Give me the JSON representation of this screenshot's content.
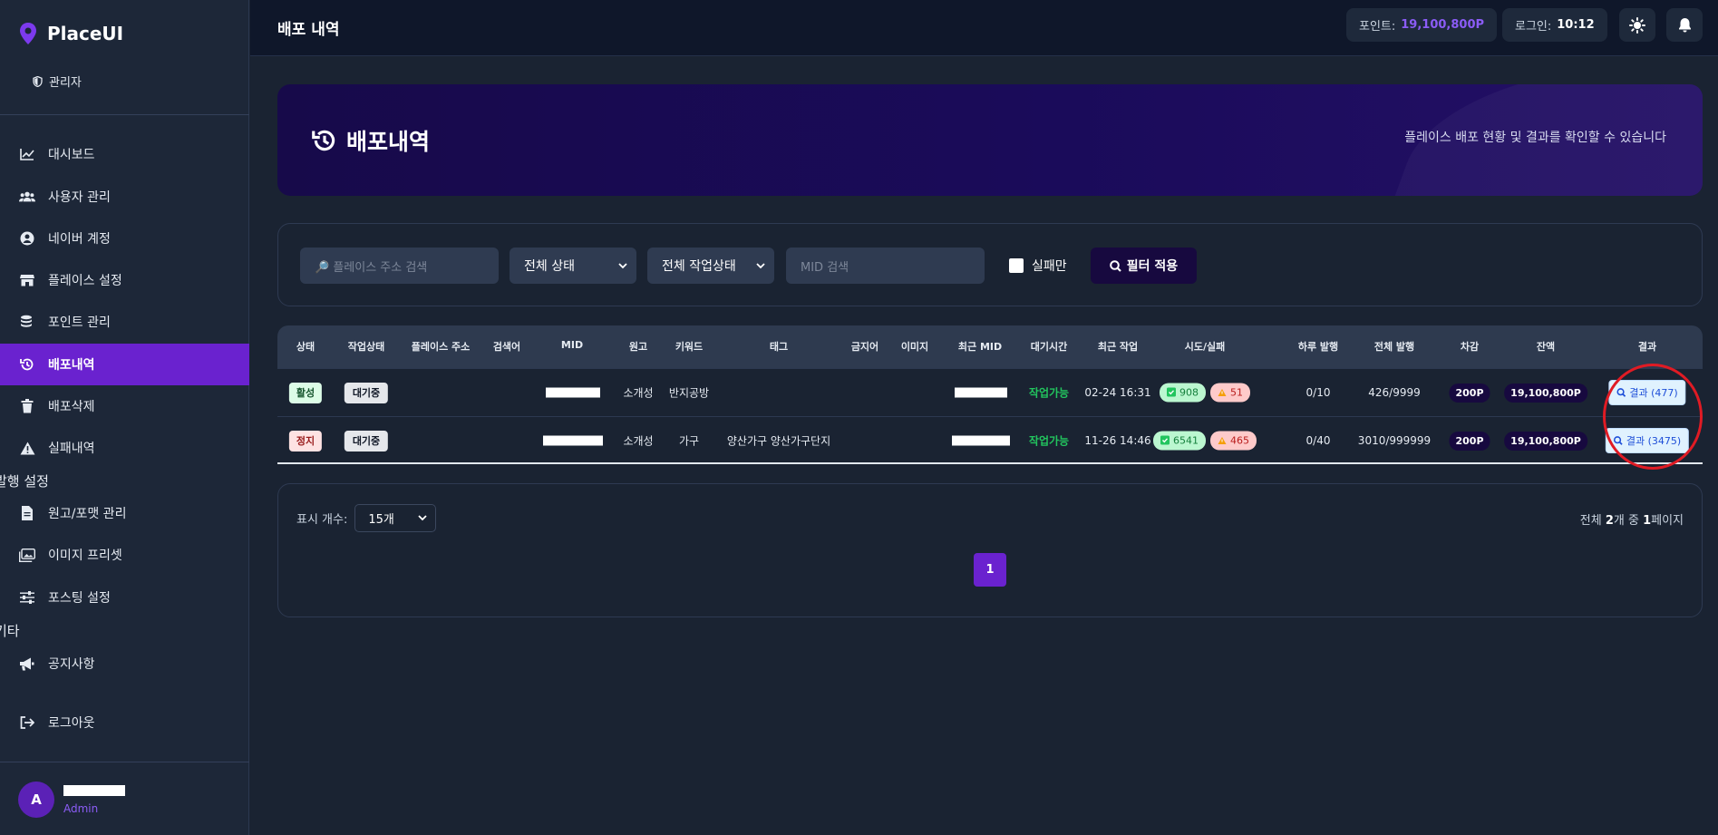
{
  "app": {
    "name": "PlaceUI",
    "role": "관리자"
  },
  "topbar": {
    "title": "배포 내역",
    "points_label": "포인트:",
    "points_value": "19,100,800P",
    "login_label": "로그인:",
    "login_value": "10:12"
  },
  "nav": {
    "items": [
      {
        "label": "대시보드",
        "icon": "chart-line-icon"
      },
      {
        "label": "사용자 관리",
        "icon": "users-icon"
      },
      {
        "label": "네이버 계정",
        "icon": "user-circle-icon"
      },
      {
        "label": "플레이스 설정",
        "icon": "store-icon"
      },
      {
        "label": "포인트 관리",
        "icon": "coins-icon"
      },
      {
        "label": "배포내역",
        "icon": "history-icon",
        "active": true
      },
      {
        "label": "배포삭제",
        "icon": "trash-icon"
      },
      {
        "label": "실패내역",
        "icon": "warning-icon"
      }
    ],
    "section_publish": "발행 설정",
    "publish_items": [
      {
        "label": "원고/포맷 관리",
        "icon": "file-icon"
      },
      {
        "label": "이미지 프리셋",
        "icon": "images-icon"
      },
      {
        "label": "포스팅 설정",
        "icon": "sliders-icon"
      }
    ],
    "section_etc": "기타",
    "etc_items": [
      {
        "label": "공지사항",
        "icon": "megaphone-icon"
      }
    ],
    "logout": "로그아웃"
  },
  "user": {
    "initial": "A",
    "role": "Admin"
  },
  "banner": {
    "title": "배포내역",
    "subtitle": "플레이스 배포 현황 및 결과를 확인할 수 있습니다"
  },
  "filters": {
    "search_placeholder": "🔎 플레이스 주소 검색",
    "status_select": "전체 상태",
    "work_status_select": "전체 작업상태",
    "mid_placeholder": "MID 검색",
    "failed_only": "실패만",
    "apply": "필터 적용"
  },
  "table": {
    "headers": [
      "상태",
      "작업상태",
      "플레이스 주소",
      "검색어",
      "MID",
      "원고",
      "키워드",
      "태그",
      "금지어",
      "이미지",
      "최근 MID",
      "대기시간",
      "최근 작업",
      "시도/실패",
      "하루 발행",
      "전체 발행",
      "차감",
      "잔액",
      "결과"
    ],
    "rows": [
      {
        "status": "활성",
        "status_type": "active",
        "work_status": "대기중",
        "manuscript": "소개성",
        "keyword": "반지공방",
        "tag": "",
        "wait": "작업가능",
        "recent": "02-24 16:31",
        "success": "908",
        "fail": "51",
        "daily": "0/10",
        "total": "426/9999",
        "deduct": "200P",
        "balance": "19,100,800P",
        "result": "결과 (477)"
      },
      {
        "status": "정지",
        "status_type": "stop",
        "work_status": "대기중",
        "manuscript": "소개성",
        "keyword": "가구",
        "tag": "양산가구 양산가구단지",
        "wait": "작업가능",
        "recent": "11-26 14:46",
        "success": "6541",
        "fail": "465",
        "daily": "0/40",
        "total": "3010/999999",
        "deduct": "200P",
        "balance": "19,100,800P",
        "result": "결과 (3475)"
      }
    ]
  },
  "pagination": {
    "per_page_label": "표시 개수:",
    "per_page_value": "15개",
    "total_prefix": "전체 ",
    "total_count": "2",
    "total_mid": "개 중 ",
    "total_pages": "1",
    "total_suffix": "페이지",
    "current_page": "1"
  }
}
